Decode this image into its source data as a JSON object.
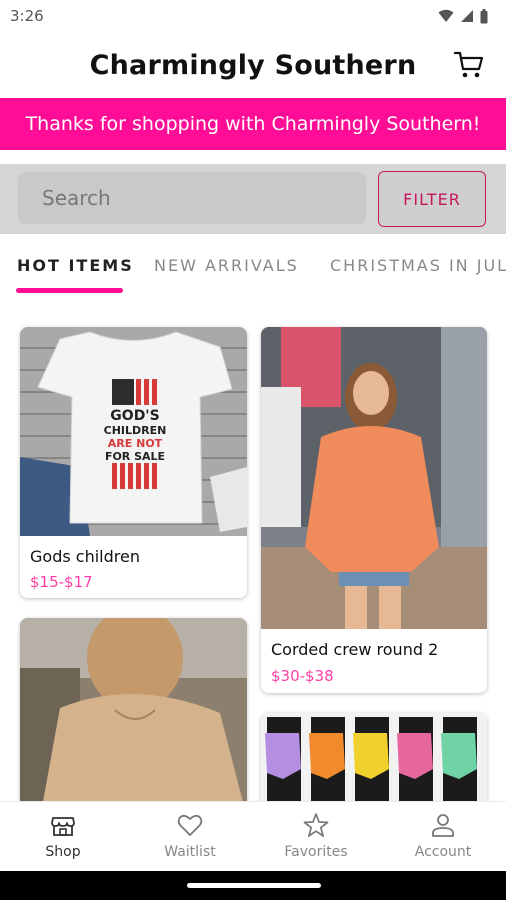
{
  "status_bar": {
    "time": "3:26"
  },
  "header": {
    "title": "Charmingly Southern"
  },
  "banner": {
    "text": "Thanks for shopping with Charmingly Southern!"
  },
  "search": {
    "placeholder": "Search",
    "filter_label": "FILTER"
  },
  "tabs": [
    {
      "label": "HOT ITEMS"
    },
    {
      "label": "NEW ARRIVALS"
    },
    {
      "label": "CHRISTMAS IN JULY"
    }
  ],
  "products": [
    {
      "name": "Gods children",
      "price": "$15-$17",
      "shirt_text": [
        "GOD'S",
        "CHILDREN",
        "ARE NOT",
        "FOR SALE"
      ]
    },
    {
      "name": "Corded crew round 2",
      "price": "$30-$38"
    },
    {
      "name": "",
      "price": ""
    },
    {
      "name": "",
      "price": ""
    }
  ],
  "bottom_nav": [
    {
      "label": "Shop",
      "icon": "store-icon"
    },
    {
      "label": "Waitlist",
      "icon": "heart-icon"
    },
    {
      "label": "Favorites",
      "icon": "star-icon"
    },
    {
      "label": "Account",
      "icon": "person-icon"
    }
  ],
  "colors": {
    "accent": "#ff0d96",
    "price": "#ff3ea5",
    "filter": "#c4185e"
  }
}
